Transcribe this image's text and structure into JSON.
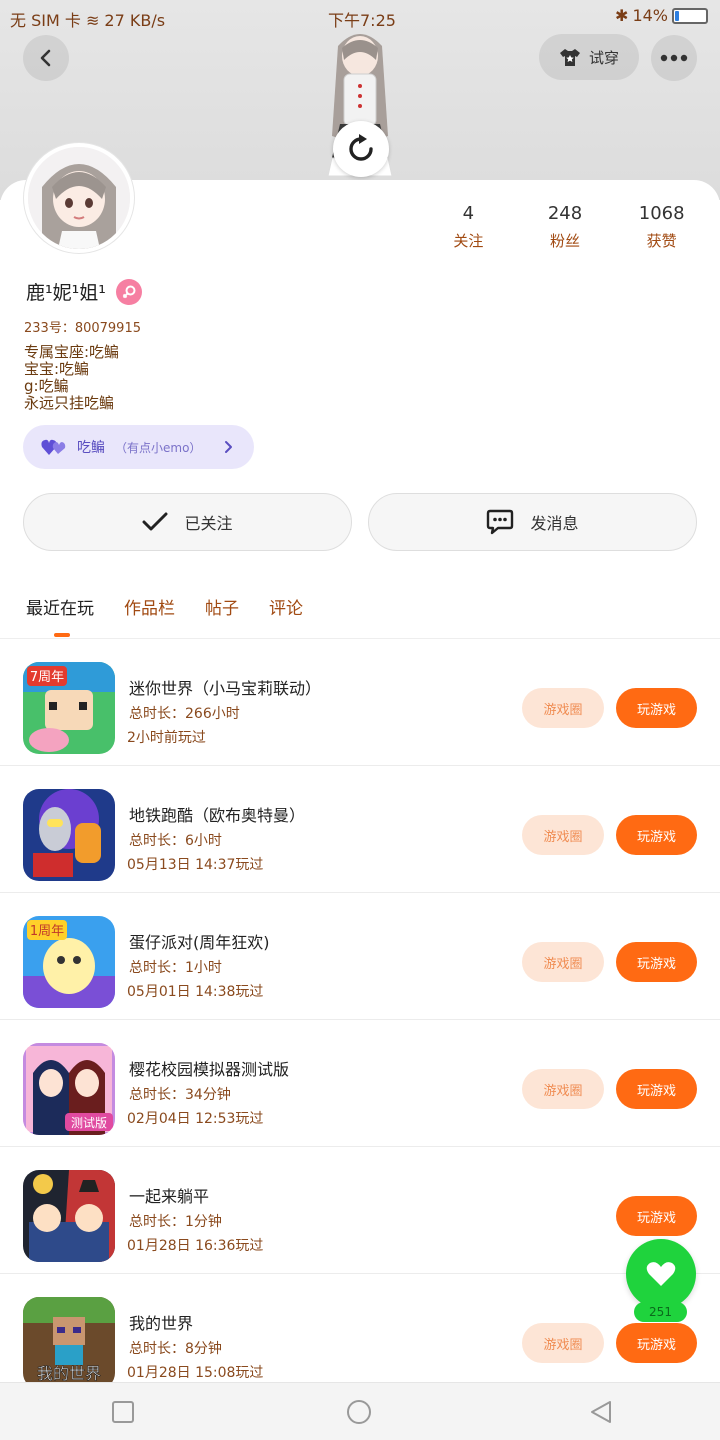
{
  "statusbar": {
    "left": "无 SIM 卡 ≋ 27 KB/s",
    "time": "下午7:25",
    "battery": "14%",
    "battery_level": 0.14
  },
  "header": {
    "dress_label": "试穿"
  },
  "profile": {
    "name": "鹿¹妮¹姐¹",
    "uid": "233号：80079915",
    "bio": [
      "专属宝座:吃鳊",
      "宝宝:吃鳊",
      "g:吃鳊",
      "永远只挂吃鳊"
    ],
    "mood_label": "吃鳊",
    "mood_sub": "（有点小emo）"
  },
  "stats": [
    {
      "value": "4",
      "label": "关注"
    },
    {
      "value": "248",
      "label": "粉丝"
    },
    {
      "value": "1068",
      "label": "获赞"
    }
  ],
  "actions": {
    "following": "已关注",
    "message": "发消息"
  },
  "tabs": [
    {
      "label": "最近在玩",
      "active": true
    },
    {
      "label": "作品栏"
    },
    {
      "label": "帖子"
    },
    {
      "label": "评论"
    }
  ],
  "games": [
    {
      "title": "迷你世界（小马宝莉联动）",
      "duration": "总时长：266小时",
      "last_played": "2小时前玩过",
      "has_circle": true
    },
    {
      "title": "地铁跑酷（欧布奥特曼）",
      "duration": "总时长：6小时",
      "last_played": "05月13日 14:37玩过",
      "has_circle": true
    },
    {
      "title": "蛋仔派对(周年狂欢)",
      "duration": "总时长：1小时",
      "last_played": "05月01日 14:38玩过",
      "has_circle": true
    },
    {
      "title": "樱花校园模拟器测试版",
      "duration": "总时长：34分钟",
      "last_played": "02月04日 12:53玩过",
      "has_circle": true
    },
    {
      "title": "一起来躺平",
      "duration": "总时长：1分钟",
      "last_played": "01月28日 16:36玩过",
      "has_circle": false
    },
    {
      "title": "我的世界",
      "duration": "总时长：8分钟",
      "last_played": "01月28日 15:08玩过",
      "has_circle": true
    }
  ],
  "game_buttons": {
    "circle": "游戏圈",
    "play": "玩游戏"
  },
  "game_icon_labels": [
    "7周年",
    "",
    "1周年",
    "测试版",
    "",
    "我的世界"
  ],
  "fab": {
    "count": "251"
  }
}
